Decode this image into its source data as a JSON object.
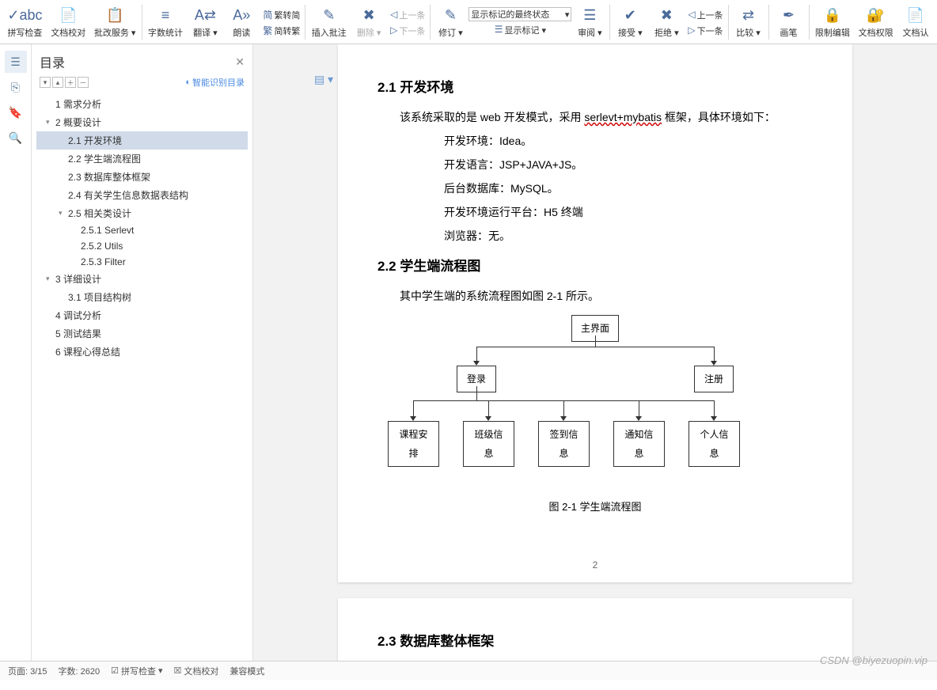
{
  "ribbon": {
    "spellcheck": "拼写检查",
    "doccheck": "文档校对",
    "review_svc": "批改服务",
    "wordcount": "字数统计",
    "translate": "翻译",
    "read": "朗读",
    "s2t": "繁转简",
    "t2s": "简转繁",
    "insert_comment": "插入批注",
    "delete": "删除",
    "prev": "上一条",
    "next": "下一条",
    "track": "修订",
    "markup_combo": "显示标记的最终状态",
    "show_markup": "显示标记",
    "review": "审阅",
    "accept": "接受",
    "reject": "拒绝",
    "prev2": "上一条",
    "next2": "下一条",
    "compare": "比较",
    "ink": "画笔",
    "restrict": "限制编辑",
    "docperm": "文档权限",
    "docauth": "文档认"
  },
  "sidebar": {
    "title": "目录",
    "smart": "智能识别目录",
    "items": [
      {
        "lv": 1,
        "t": "1  需求分析"
      },
      {
        "lv": 1,
        "t": "2  概要设计",
        "caret": "▾"
      },
      {
        "lv": 2,
        "t": "2.1  开发环境",
        "active": true
      },
      {
        "lv": 2,
        "t": "2.2  学生端流程图"
      },
      {
        "lv": 2,
        "t": "2.3  数据库整体框架"
      },
      {
        "lv": 2,
        "t": "2.4  有关学生信息数据表结构"
      },
      {
        "lv": 2,
        "t": "2.5  相关类设计",
        "caret": "▾"
      },
      {
        "lv": 3,
        "t": "2.5.1 Serlevt"
      },
      {
        "lv": 3,
        "t": "2.5.2 Utils"
      },
      {
        "lv": 3,
        "t": "2.5.3 Filter"
      },
      {
        "lv": 1,
        "t": "3  详细设计",
        "caret": "▾"
      },
      {
        "lv": 2,
        "t": "3.1  项目结构树"
      },
      {
        "lv": 1,
        "t": "4  调试分析"
      },
      {
        "lv": 1,
        "t": "5  测试结果"
      },
      {
        "lv": 1,
        "t": "6  课程心得总结"
      }
    ]
  },
  "doc": {
    "h21": "2.1  开发环境",
    "p1a": "该系统采取的是 web 开发模式，采用 ",
    "p1u": "serlevt+mybatis",
    "p1b": " 框架，具体环境如下：",
    "env1": "开发环境：Idea。",
    "env2": "开发语言：JSP+JAVA+JS。",
    "env3": "后台数据库：MySQL。",
    "env4": "开发环境运行平台：H5 终端",
    "env5": "浏览器：无。",
    "h22": "2.2  学生端流程图",
    "p2": "其中学生端的系统流程图如图 2-1 所示。",
    "figcap": "图 2-1  学生端流程图",
    "pgnum": "2",
    "h23": "2.3  数据库整体框架"
  },
  "flow": {
    "n1": "主界面",
    "n2": "登录",
    "n3": "注册",
    "n4": "课程安排",
    "n5": "班级信息",
    "n6": "签到信息",
    "n7": "通知信息",
    "n8": "个人信息"
  },
  "status": {
    "page": "页面: 3/15",
    "words": "字数: 2620",
    "spell": "拼写检查",
    "proof": "文档校对",
    "mode": "兼容模式"
  },
  "watermark": "CSDN @biyezuopin.vip"
}
